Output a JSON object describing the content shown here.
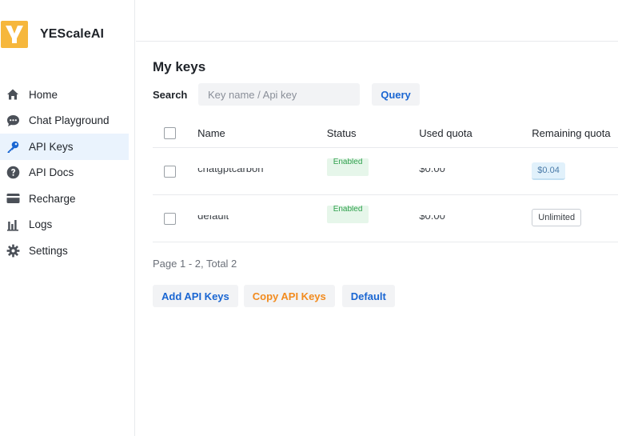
{
  "brand": {
    "name": "YEScaleAI",
    "logo_color": "#f6b73c"
  },
  "sidebar": {
    "items": [
      {
        "label": "Home",
        "icon": "home-icon"
      },
      {
        "label": "Chat Playground",
        "icon": "chat-icon"
      },
      {
        "label": "API Keys",
        "icon": "key-icon",
        "active": true
      },
      {
        "label": "API Docs",
        "icon": "help-icon"
      },
      {
        "label": "Recharge",
        "icon": "credit-card-icon"
      },
      {
        "label": "Logs",
        "icon": "bar-chart-icon"
      },
      {
        "label": "Settings",
        "icon": "gear-icon"
      }
    ]
  },
  "main": {
    "title": "My keys",
    "search": {
      "label": "Search",
      "placeholder": "Key name / Api key",
      "value": "",
      "query_label": "Query"
    },
    "table": {
      "columns": [
        "Name",
        "Status",
        "Used quota",
        "Remaining quota"
      ],
      "rows": [
        {
          "name": "chatgptcarbon",
          "status": "Enabled",
          "used": "$0.00",
          "remaining": "$0.04"
        },
        {
          "name": "default",
          "status": "Enabled",
          "used": "$0.00",
          "remaining": "Unlimited"
        }
      ]
    },
    "pager": "Page 1 - 2, Total 2",
    "actions": {
      "add": "Add API Keys",
      "copy": "Copy API Keys",
      "default": "Default"
    }
  },
  "colors": {
    "accent": "#1a66d2",
    "copy_orange": "#f28b1e",
    "status_green": "#2ea04c",
    "active_bg": "#eaf3fd"
  }
}
